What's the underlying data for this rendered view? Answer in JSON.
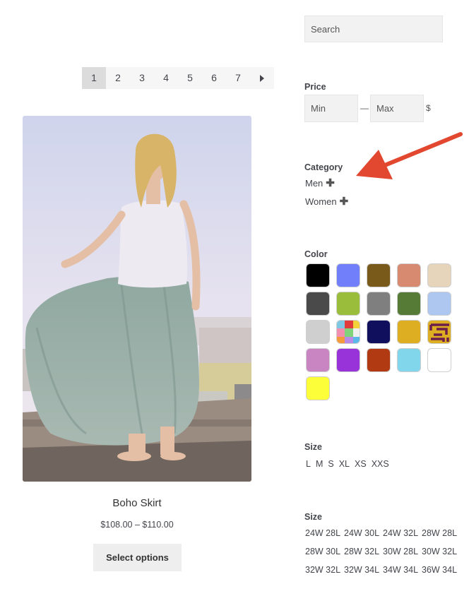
{
  "pagination": {
    "pages": [
      "1",
      "2",
      "3",
      "4",
      "5",
      "6",
      "7"
    ],
    "current": "1",
    "next_icon": "triangle-right-icon"
  },
  "product": {
    "title": "Boho Skirt",
    "price": "$108.00 – $110.00",
    "button_label": "Select options"
  },
  "search": {
    "placeholder": "Search"
  },
  "price_filter": {
    "title": "Price",
    "min_placeholder": "Min",
    "max_placeholder": "Max",
    "separator": "—",
    "currency": "$"
  },
  "category": {
    "title": "Category",
    "items": [
      {
        "label": "Men",
        "icon": "plus-icon"
      },
      {
        "label": "Women",
        "icon": "plus-icon"
      }
    ]
  },
  "color": {
    "title": "Color",
    "swatches": [
      "#000000",
      "#717ffa",
      "#7a5a1a",
      "#d78a70",
      "#e6d5bb",
      "#4a4a4a",
      "#9abd3c",
      "#7f7f7f",
      "#567b37",
      "#aec7f0",
      "#cfcfcf",
      "multicolor",
      "#0f0f5e",
      "#deae22",
      "pattern",
      "#c984c2",
      "#9733d9",
      "#b23a12",
      "#82d6ec",
      "#ffffff",
      "#fdfe3a"
    ]
  },
  "size": {
    "title": "Size",
    "items": [
      "L",
      "M",
      "S",
      "XL",
      "XS",
      "XXS"
    ]
  },
  "size2": {
    "title": "Size",
    "items": [
      "24W 28L",
      "24W 30L",
      "24W 32L",
      "28W 28L",
      "28W 30L",
      "28W 32L",
      "30W 28L",
      "30W 32L",
      "32W 32L",
      "32W 34L",
      "34W 34L",
      "36W 34L"
    ]
  },
  "annotation": {
    "color": "#e2472f"
  }
}
